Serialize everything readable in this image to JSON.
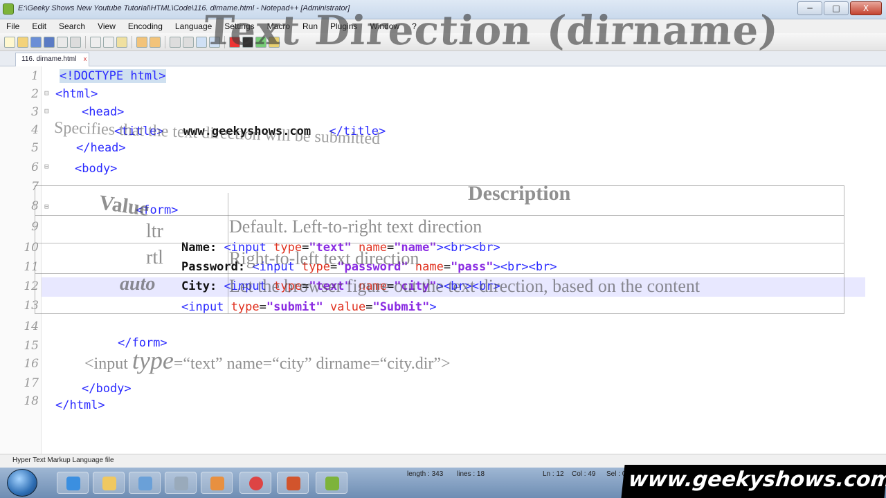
{
  "window": {
    "title": "E:\\Geeky Shows New Youtube Tutorial\\HTML\\Code\\116. dirname.html - Notepad++ [Administrator]",
    "buttons": {
      "minimize": "─",
      "maximize": "□",
      "close": "X"
    }
  },
  "menubar": [
    "File",
    "Edit",
    "Search",
    "View",
    "Encoding",
    "Language",
    "Settings",
    "Macro",
    "Run",
    "Plugins",
    "Window",
    "?"
  ],
  "tabs": [
    {
      "label": "116. dirname.html",
      "close": "x"
    }
  ],
  "editor": {
    "line_numbers": [
      "1",
      "2",
      "3",
      "4",
      "5",
      "6",
      "7",
      "8",
      "9",
      "10",
      "11",
      "12",
      "13",
      "14",
      "15",
      "16",
      "17",
      "18"
    ],
    "code": {
      "l1": "<!DOCTYPE html>",
      "l2": "<html>",
      "l3": "<head>",
      "l4_open": "<title>",
      "l4_text": "www.geekyshows.com",
      "l4_close": "</title>",
      "l5": "</head>",
      "l6": "<body>",
      "l8": "<form>",
      "l10_label": "Name:",
      "l10_open": "<input",
      "l10_type_attr": "type",
      "l10_type_val": "\"text\"",
      "l10_name_attr": "name",
      "l10_name_val": "\"name\"",
      "l10_close": "><br><br>",
      "l11_label": "Password:",
      "l11_open": "<input",
      "l11_type_attr": "type",
      "l11_type_val": "\"password\"",
      "l11_name_attr": "name",
      "l11_name_val": "\"pass\"",
      "l11_close": "><br><br>",
      "l12_label": "City:",
      "l12_open": "<input",
      "l12_type_attr": "type",
      "l12_type_val": "\"text\"",
      "l12_name_attr": "name",
      "l12_name_val": "\"city\"",
      "l12_close": "><br><br>",
      "l13_open": "<input",
      "l13_type_attr": "type",
      "l13_type_val": "\"submit\"",
      "l13_value_attr": "value",
      "l13_value_val": "\"Submit\"",
      "l13_close": ">",
      "l15": "</form>",
      "l17": "</body>",
      "l18": "</html>"
    }
  },
  "overlay": {
    "title": "Text Direction (dirname)",
    "subtitle": "Specifies that the text direction will be submitted",
    "table": {
      "header_value": "Value",
      "header_description": "Description",
      "rows": [
        {
          "value": "ltr",
          "description": "Default. Left-to-right text direction"
        },
        {
          "value": "rtl",
          "description": "Right-to-left text direction"
        },
        {
          "value": "auto",
          "description": "Let the browser figure out the text direction, based on the content"
        }
      ]
    },
    "example": {
      "tag": "<input",
      "type_kw": "type",
      "rest": "=“text” name=“city” dirname=“city.dir”>"
    }
  },
  "statusbar": {
    "file_type": "Hyper Text Markup Language file",
    "length": "length : 343",
    "lines": "lines : 18",
    "line": "Ln : 12",
    "col": "Col : 49",
    "sel": "Sel : 0"
  },
  "watermark": "www.geekyshows.com",
  "colors": {
    "tag": "#2a2aff",
    "attr": "#e0301e",
    "string": "#8a2be2",
    "taskbar": "#6e8db3"
  }
}
